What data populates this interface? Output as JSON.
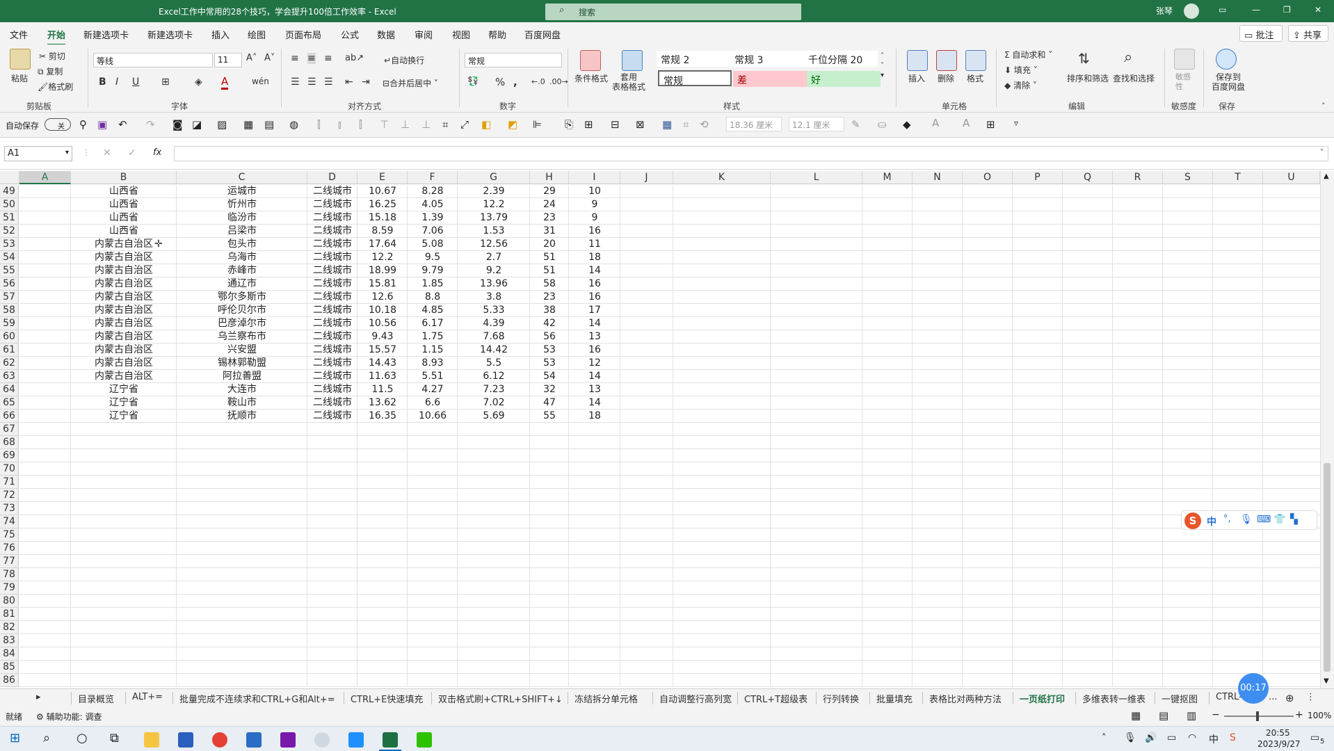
{
  "window": {
    "title": "Excel工作中常用的28个技巧，学会提升100倍工作效率 - Excel",
    "search_placeholder": "搜索",
    "user": "张琴"
  },
  "menu": [
    "文件",
    "开始",
    "新建选项卡",
    "新建选项卡",
    "插入",
    "绘图",
    "页面布局",
    "公式",
    "数据",
    "审阅",
    "视图",
    "帮助",
    "百度网盘"
  ],
  "menu_right": {
    "comment": "批注",
    "share": "共享"
  },
  "ribbon": {
    "clipboard": {
      "paste": "粘贴",
      "cut": "剪切",
      "copy": "复制",
      "format_painter": "格式刷",
      "group": "剪贴板"
    },
    "font": {
      "name": "等线",
      "size": "11",
      "group": "字体"
    },
    "alignment": {
      "wrap": "自动换行",
      "merge": "合并后居中",
      "group": "对齐方式"
    },
    "number": {
      "format": "常规",
      "group": "数字"
    },
    "styles": {
      "cond_format": "条件格式",
      "table_format": "套用\n表格格式",
      "s1": "常规 2",
      "s2": "常规 3",
      "s3": "千位分隔 20",
      "s4": "常规",
      "s5": "差",
      "s6": "好",
      "group": "样式"
    },
    "cells": {
      "insert": "插入",
      "delete": "删除",
      "format": "格式",
      "group": "单元格"
    },
    "editing": {
      "autosum": "自动求和",
      "fill": "填充",
      "clear": "清除",
      "sort": "排序和筛选",
      "find": "查找和选择",
      "group": "编辑"
    },
    "sensitivity": {
      "label": "敏感\n性",
      "group": "敏感度"
    },
    "save": {
      "label": "保存到\n百度网盘",
      "group": "保存"
    }
  },
  "qat": {
    "autosave": "自动保存",
    "toggle": "关",
    "width": "18.36 厘米",
    "height": "12.1 厘米"
  },
  "namebox": "A1",
  "fx": "fx",
  "columns": [
    "A",
    "B",
    "C",
    "D",
    "E",
    "F",
    "G",
    "H",
    "I",
    "J",
    "K",
    "L",
    "M",
    "N",
    "O",
    "P",
    "Q",
    "R",
    "S",
    "T",
    "U"
  ],
  "rows": [
    {
      "n": "49",
      "b": "山西省",
      "c": "运城市",
      "d": "二线城市",
      "e": "10.67",
      "f": "8.28",
      "g": "2.39",
      "h": "29",
      "i": "10"
    },
    {
      "n": "50",
      "b": "山西省",
      "c": "忻州市",
      "d": "二线城市",
      "e": "16.25",
      "f": "4.05",
      "g": "12.2",
      "h": "24",
      "i": "9"
    },
    {
      "n": "51",
      "b": "山西省",
      "c": "临汾市",
      "d": "二线城市",
      "e": "15.18",
      "f": "1.39",
      "g": "13.79",
      "h": "23",
      "i": "9"
    },
    {
      "n": "52",
      "b": "山西省",
      "c": "吕梁市",
      "d": "二线城市",
      "e": "8.59",
      "f": "7.06",
      "g": "1.53",
      "h": "31",
      "i": "16"
    },
    {
      "n": "53",
      "b": "内蒙古自治区",
      "c": "包头市",
      "d": "二线城市",
      "e": "17.64",
      "f": "5.08",
      "g": "12.56",
      "h": "20",
      "i": "11"
    },
    {
      "n": "54",
      "b": "内蒙古自治区",
      "c": "乌海市",
      "d": "二线城市",
      "e": "12.2",
      "f": "9.5",
      "g": "2.7",
      "h": "51",
      "i": "18"
    },
    {
      "n": "55",
      "b": "内蒙古自治区",
      "c": "赤峰市",
      "d": "二线城市",
      "e": "18.99",
      "f": "9.79",
      "g": "9.2",
      "h": "51",
      "i": "14"
    },
    {
      "n": "56",
      "b": "内蒙古自治区",
      "c": "通辽市",
      "d": "二线城市",
      "e": "15.81",
      "f": "1.85",
      "g": "13.96",
      "h": "58",
      "i": "16"
    },
    {
      "n": "57",
      "b": "内蒙古自治区",
      "c": "鄂尔多斯市",
      "d": "二线城市",
      "e": "12.6",
      "f": "8.8",
      "g": "3.8",
      "h": "23",
      "i": "16"
    },
    {
      "n": "58",
      "b": "内蒙古自治区",
      "c": "呼伦贝尔市",
      "d": "二线城市",
      "e": "10.18",
      "f": "4.85",
      "g": "5.33",
      "h": "38",
      "i": "17"
    },
    {
      "n": "59",
      "b": "内蒙古自治区",
      "c": "巴彦淖尔市",
      "d": "二线城市",
      "e": "10.56",
      "f": "6.17",
      "g": "4.39",
      "h": "42",
      "i": "14"
    },
    {
      "n": "60",
      "b": "内蒙古自治区",
      "c": "乌兰察布市",
      "d": "二线城市",
      "e": "9.43",
      "f": "1.75",
      "g": "7.68",
      "h": "56",
      "i": "13"
    },
    {
      "n": "61",
      "b": "内蒙古自治区",
      "c": "兴安盟",
      "d": "二线城市",
      "e": "15.57",
      "f": "1.15",
      "g": "14.42",
      "h": "53",
      "i": "16"
    },
    {
      "n": "62",
      "b": "内蒙古自治区",
      "c": "锡林郭勒盟",
      "d": "二线城市",
      "e": "14.43",
      "f": "8.93",
      "g": "5.5",
      "h": "53",
      "i": "12"
    },
    {
      "n": "63",
      "b": "内蒙古自治区",
      "c": "阿拉善盟",
      "d": "二线城市",
      "e": "11.63",
      "f": "5.51",
      "g": "6.12",
      "h": "54",
      "i": "14"
    },
    {
      "n": "64",
      "b": "辽宁省",
      "c": "大连市",
      "d": "二线城市",
      "e": "11.5",
      "f": "4.27",
      "g": "7.23",
      "h": "32",
      "i": "13"
    },
    {
      "n": "65",
      "b": "辽宁省",
      "c": "鞍山市",
      "d": "二线城市",
      "e": "13.62",
      "f": "6.6",
      "g": "7.02",
      "h": "47",
      "i": "14"
    },
    {
      "n": "66",
      "b": "辽宁省",
      "c": "抚顺市",
      "d": "二线城市",
      "e": "16.35",
      "f": "10.66",
      "g": "5.69",
      "h": "55",
      "i": "18"
    }
  ],
  "empty_rows": [
    "67",
    "68",
    "69",
    "70",
    "71",
    "72",
    "73",
    "74",
    "75",
    "76",
    "77",
    "78",
    "79",
    "80",
    "81",
    "82",
    "83",
    "84",
    "85",
    "86"
  ],
  "sheet_tabs": [
    "目录概览",
    "ALT+=",
    "批量完成不连续求和CTRL+G和Alt+=",
    "CTRL+E快速填充",
    "双击格式刷+CTRL+SHIFT+↓",
    "冻结拆分单元格",
    "自动调整行高列宽",
    "CTRL+T超级表",
    "行列转换",
    "批量填充",
    "表格比对两种方法",
    "一页纸打印",
    "多维表转一维表",
    "一键抠图",
    "CTRL-"
  ],
  "active_tab": "一页纸打印",
  "timer": "00:17",
  "status": {
    "ready": "就绪",
    "accessibility": "辅助功能: 调查",
    "zoom": "100%"
  },
  "ime": {
    "lang": "中"
  },
  "clock": {
    "time": "20:55",
    "date": "2023/9/27",
    "notif": "5"
  },
  "colors": {
    "excel_green": "#217346",
    "bad_bg": "#ffc7ce",
    "good_bg": "#c6efce"
  }
}
